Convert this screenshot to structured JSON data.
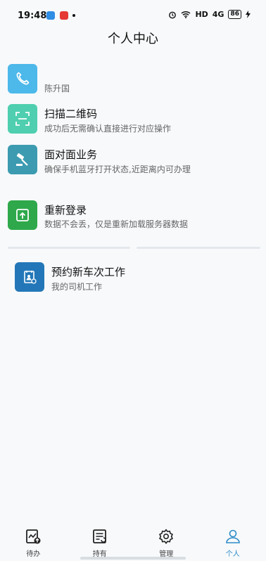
{
  "status_bar": {
    "time": "19:48",
    "network": "HD",
    "signal": "4G",
    "battery": "86"
  },
  "page_title": "个人中心",
  "menu": [
    {
      "icon": "phone-icon",
      "title": "",
      "subtitle": "陈升国",
      "color": "#4db8ea"
    },
    {
      "icon": "scan-icon",
      "title": "扫描二维码",
      "subtitle": "成功后无需确认直接进行对应操作",
      "color": "#4fcfaf"
    },
    {
      "icon": "gavel-icon",
      "title": "面对面业务",
      "subtitle": "确保手机蓝牙打开状态,近距离内可办理",
      "color": "#3c9bb0"
    },
    {
      "icon": "relogin-icon",
      "title": "重新登录",
      "subtitle": "数据不会丢，仅是重新加载服务器数据",
      "color": "#2ea84a"
    },
    {
      "icon": "reserve-icon",
      "title": "预约新车次工作",
      "subtitle": "我的司机工作",
      "color": "#2377b8"
    }
  ],
  "tabs": [
    {
      "label": "待办",
      "icon": "todo-upload-icon",
      "active": false
    },
    {
      "label": "持有",
      "icon": "holding-list-icon",
      "active": false
    },
    {
      "label": "管理",
      "icon": "gear-icon",
      "active": false
    },
    {
      "label": "个人",
      "icon": "person-icon",
      "active": true
    }
  ],
  "colors": {
    "accent": "#2d8cc7",
    "background": "#f7f9fb"
  }
}
